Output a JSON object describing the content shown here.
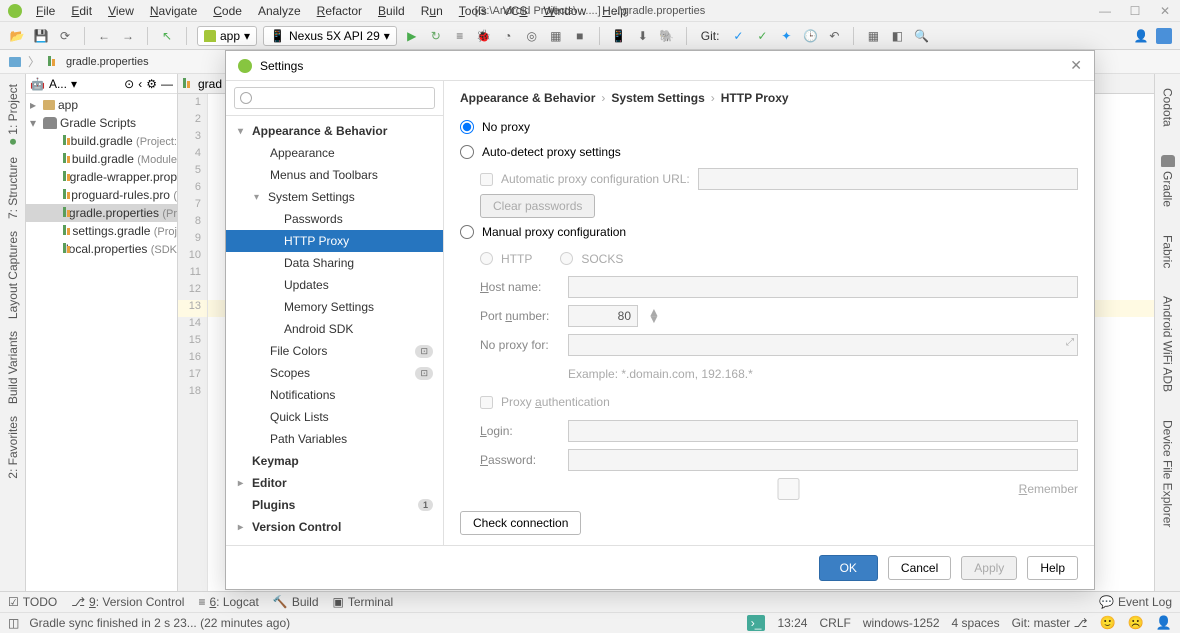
{
  "window": {
    "title": "[G:\\Android Projects\\ ......] - ...\\gradle.properties"
  },
  "menu": {
    "file": "File",
    "edit": "Edit",
    "view": "View",
    "navigate": "Navigate",
    "code": "Code",
    "analyze": "Analyze",
    "refactor": "Refactor",
    "build": "Build",
    "run": "Run",
    "tools": "Tools",
    "vcs": "VCS",
    "window": "Window",
    "help": "Help"
  },
  "toolbar": {
    "config": "app",
    "device": "Nexus 5X API 29",
    "git_label": "Git:"
  },
  "breadcrumb": {
    "file": "gradle.properties"
  },
  "left_tools": {
    "project": "1: Project",
    "structure": "7: Structure",
    "layout_captures": "Layout Captures",
    "build_variants": "Build Variants",
    "favorites": "2: Favorites"
  },
  "right_tools": {
    "codota": "Codota",
    "gradle": "Gradle",
    "fabric": "Fabric",
    "wifi_adb": "Android WiFi ADB",
    "device_explorer": "Device File Explorer"
  },
  "project_tree": {
    "header": "A...",
    "root_app": "app",
    "gradle_scripts": "Gradle Scripts",
    "files": [
      {
        "name": "build.gradle",
        "hint": "(Project:"
      },
      {
        "name": "build.gradle",
        "hint": "(Module"
      },
      {
        "name": "gradle-wrapper.prop",
        "hint": ""
      },
      {
        "name": "proguard-rules.pro",
        "hint": "("
      },
      {
        "name": "gradle.properties",
        "hint": "(Pr",
        "selected": true
      },
      {
        "name": "settings.gradle",
        "hint": "(Proj"
      },
      {
        "name": "local.properties",
        "hint": "(SDK"
      }
    ]
  },
  "editor": {
    "tab": "grad",
    "lines": [
      "1",
      "2",
      "3",
      "4",
      "5",
      "6",
      "7",
      "8",
      "9",
      "10",
      "11",
      "12",
      "13",
      "14",
      "15",
      "16",
      "17",
      "18"
    ]
  },
  "settings": {
    "title": "Settings",
    "search_placeholder": "",
    "crumb1": "Appearance & Behavior",
    "crumb2": "System Settings",
    "crumb3": "HTTP Proxy",
    "tree": {
      "appearance_behavior": "Appearance & Behavior",
      "appearance": "Appearance",
      "menus_toolbars": "Menus and Toolbars",
      "system_settings": "System Settings",
      "passwords": "Passwords",
      "http_proxy": "HTTP Proxy",
      "data_sharing": "Data Sharing",
      "updates": "Updates",
      "memory_settings": "Memory Settings",
      "android_sdk": "Android SDK",
      "file_colors": "File Colors",
      "scopes": "Scopes",
      "notifications": "Notifications",
      "quick_lists": "Quick Lists",
      "path_variables": "Path Variables",
      "keymap": "Keymap",
      "editor": "Editor",
      "plugins": "Plugins",
      "plugins_badge": "1",
      "version_control": "Version Control"
    },
    "proxy": {
      "no_proxy": "No proxy",
      "auto_detect": "Auto-detect proxy settings",
      "auto_config_url": "Automatic proxy configuration URL:",
      "clear_passwords": "Clear passwords",
      "manual": "Manual proxy configuration",
      "http_opt": "HTTP",
      "socks_opt": "SOCKS",
      "host_name": "Host name:",
      "port_number": "Port number:",
      "port_value": "80",
      "no_proxy_for": "No proxy for:",
      "example": "Example: *.domain.com, 192.168.*",
      "proxy_auth": "Proxy authentication",
      "login": "Login:",
      "password": "Password:",
      "remember": "Remember",
      "check_connection": "Check connection"
    },
    "buttons": {
      "ok": "OK",
      "cancel": "Cancel",
      "apply": "Apply",
      "help": "Help"
    }
  },
  "bottom_toolbar": {
    "todo": "TODO",
    "vc": "9: Version Control",
    "logcat": "6: Logcat",
    "build": "Build",
    "terminal": "Terminal",
    "event_log": "Event Log"
  },
  "status": {
    "message": "Gradle sync finished in 2 s 23... (22 minutes ago)",
    "time": "13:24",
    "line_sep": "CRLF",
    "encoding": "windows-1252",
    "indent": "4 spaces",
    "git": "Git: master"
  }
}
